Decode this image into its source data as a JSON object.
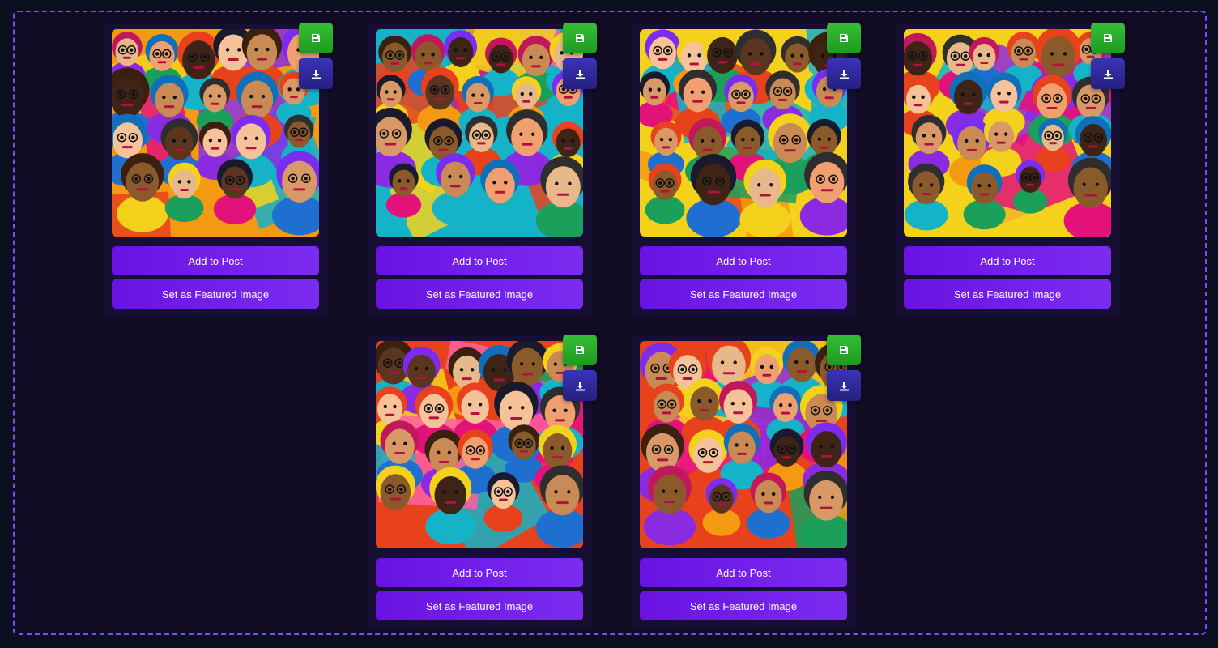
{
  "colors": {
    "accent": "#7b2cf0",
    "save": "#2eb32f",
    "download": "#2f29a0",
    "border": "#7c4dff"
  },
  "cards": [
    {
      "add_label": "Add to Post",
      "featured_label": "Set as Featured Image",
      "save_icon": "floppy-disk-icon",
      "download_icon": "download-icon"
    },
    {
      "add_label": "Add to Post",
      "featured_label": "Set as Featured Image",
      "save_icon": "floppy-disk-icon",
      "download_icon": "download-icon"
    },
    {
      "add_label": "Add to Post",
      "featured_label": "Set as Featured Image",
      "save_icon": "floppy-disk-icon",
      "download_icon": "download-icon"
    },
    {
      "add_label": "Add to Post",
      "featured_label": "Set as Featured Image",
      "save_icon": "floppy-disk-icon",
      "download_icon": "download-icon"
    },
    {
      "add_label": "Add to Post",
      "featured_label": "Set as Featured Image",
      "save_icon": "floppy-disk-icon",
      "download_icon": "download-icon"
    },
    {
      "add_label": "Add to Post",
      "featured_label": "Set as Featured Image",
      "save_icon": "floppy-disk-icon",
      "download_icon": "download-icon"
    }
  ]
}
